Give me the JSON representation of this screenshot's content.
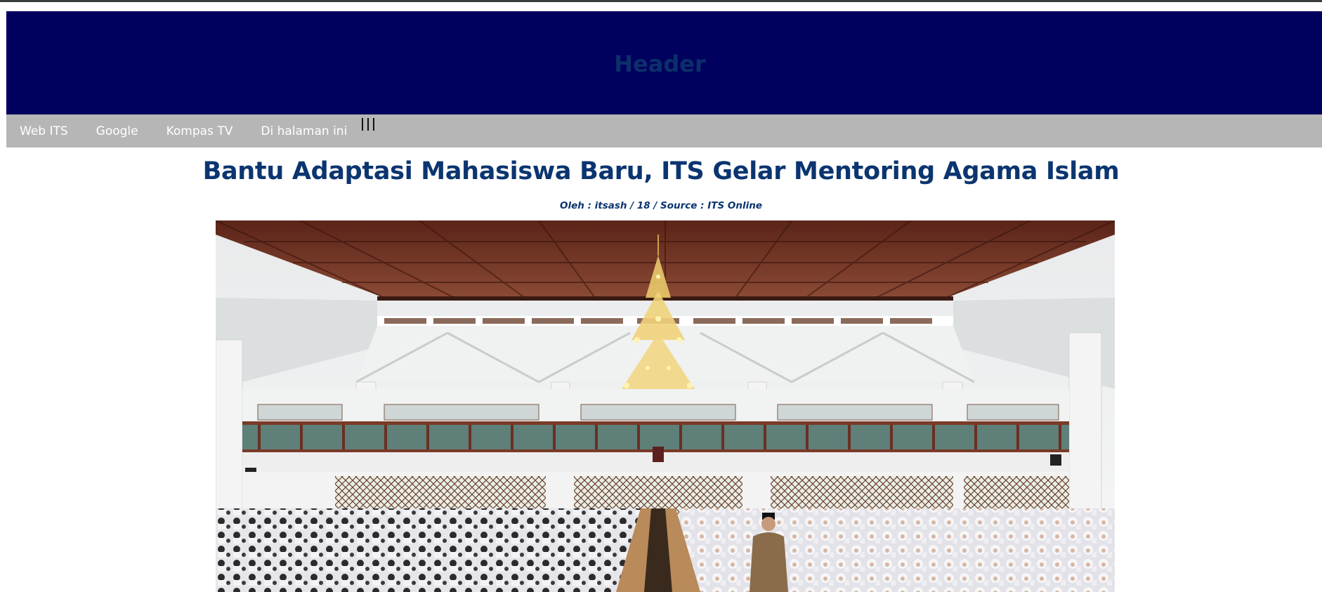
{
  "header": {
    "title": "Header"
  },
  "nav": {
    "links": [
      "Web ITS",
      "Google",
      "Kompas TV",
      "Di halaman ini"
    ],
    "menu_icon": "hamburger-vertical-icon"
  },
  "article": {
    "title": "Bantu Adaptasi Mahasiswa Baru, ITS Gelar Mentoring Agama Islam",
    "byline": "Oleh : itsash / 18 / Source : ITS Online"
  },
  "colors": {
    "header_bg": "#00005e",
    "nav_bg": "#b6b6b6",
    "title_color": "#0b3570"
  }
}
